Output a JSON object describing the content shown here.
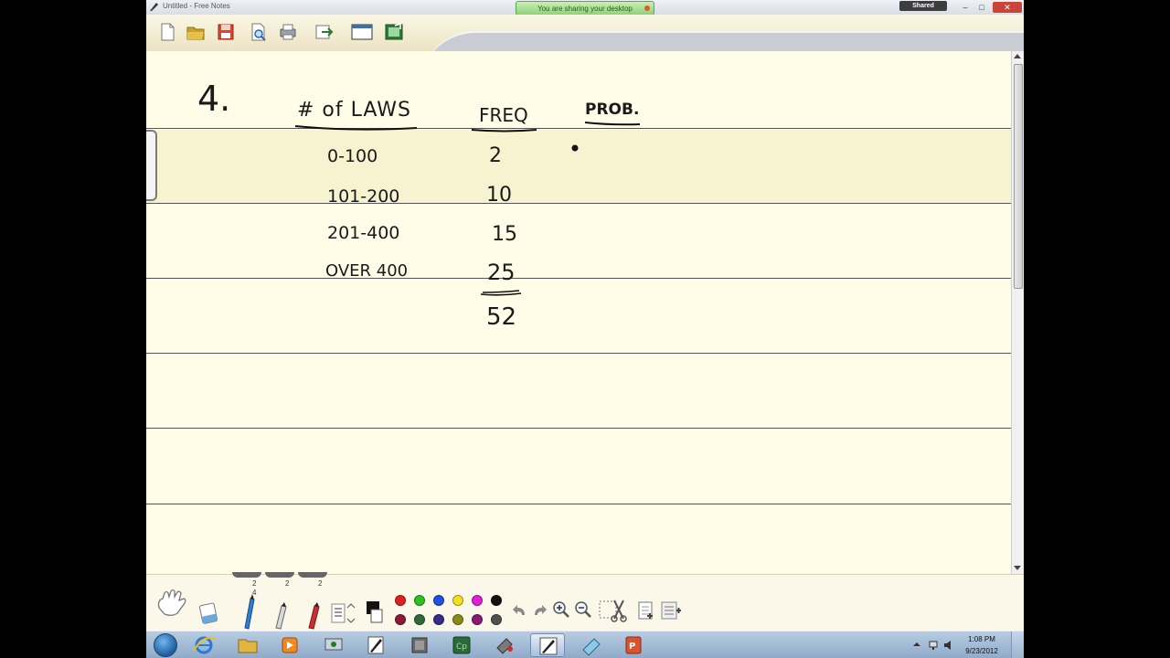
{
  "window": {
    "title": "Untitled - Free Notes",
    "share_banner": "You are sharing your desktop",
    "shared_tab": "Shared",
    "min_symbol": "–",
    "max_symbol": "□",
    "close_symbol": "✕"
  },
  "toolbar": {
    "icons": [
      "new-file-icon",
      "open-folder-icon",
      "save-icon",
      "print-preview-icon",
      "print-icon",
      "export-icon",
      "window-icon",
      "insert-image-icon"
    ]
  },
  "notes": {
    "problem_number": "4.",
    "headers": {
      "laws": "# of LAWS",
      "freq": "FREQ",
      "prob": "PROB."
    },
    "rows": [
      {
        "range": "0-100",
        "freq": "2"
      },
      {
        "range": "101-200",
        "freq": "10"
      },
      {
        "range": "201-400",
        "freq": "15"
      },
      {
        "range": "OVER 400",
        "freq": "25"
      }
    ],
    "total": "52"
  },
  "tools": {
    "pen_counts": [
      "2",
      "2",
      "2"
    ],
    "pen_sub_label": "4",
    "colors": [
      "#e02020",
      "#2fc020",
      "#2050e0",
      "#f0e020",
      "#e020d8",
      "#111111",
      "#8b1a3a",
      "#2e6b3a",
      "#3a2a8a",
      "#8a8a1a",
      "#8a1a7a",
      "#505050"
    ]
  },
  "taskbar": {
    "time": "1:08 PM",
    "date": "9/23/2012",
    "items": [
      "ie-icon",
      "explorer-icon",
      "media-icon",
      "network-icon",
      "notes-icon",
      "app-icon",
      "captivate-icon",
      "tool-icon",
      "pen-app-icon",
      "eraser-app-icon",
      "powerpoint-icon"
    ]
  }
}
